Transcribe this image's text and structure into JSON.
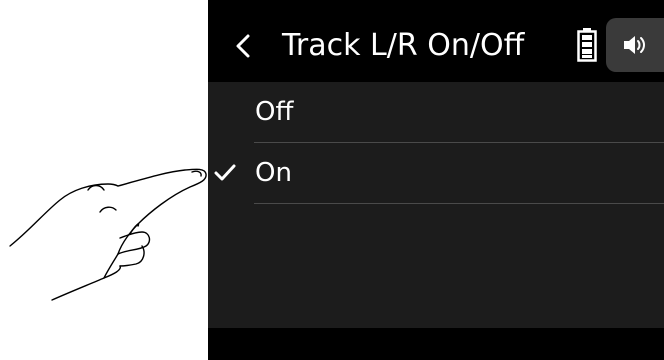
{
  "header": {
    "title": "Track L/R On/Off",
    "back_icon": "chevron-left-icon",
    "battery_icon": "battery-icon",
    "speaker_icon": "speaker-icon"
  },
  "options": [
    {
      "label": "Off",
      "selected": false
    },
    {
      "label": "On",
      "selected": true
    }
  ],
  "colors": {
    "title_bar": "#000000",
    "list_background": "#1c1c1c",
    "divider": "#4a4a4a",
    "text": "#ffffff",
    "speaker_tab": "#3a3a3a"
  }
}
